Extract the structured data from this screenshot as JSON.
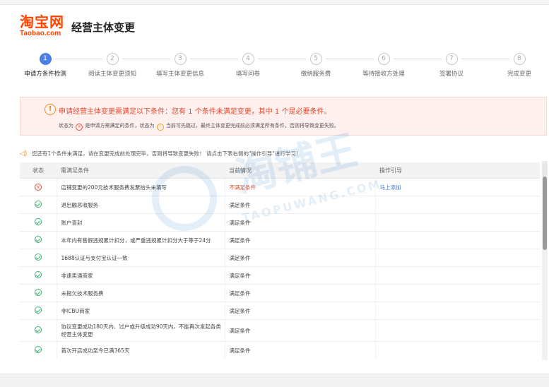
{
  "logo": {
    "cn": "淘宝网",
    "en": "Taobao.com"
  },
  "page_title": "经营主体变更",
  "steps": [
    {
      "num": "1",
      "label": "申请方条件检测",
      "active": true
    },
    {
      "num": "2",
      "label": "阅读主体变更须知",
      "active": false
    },
    {
      "num": "3",
      "label": "填写主体变更信息",
      "active": false
    },
    {
      "num": "4",
      "label": "填写问卷",
      "active": false
    },
    {
      "num": "5",
      "label": "缴纳服务费",
      "active": false
    },
    {
      "num": "6",
      "label": "等待接收方处理",
      "active": false
    },
    {
      "num": "7",
      "label": "签署协议",
      "active": false
    },
    {
      "num": "8",
      "label": "完成变更",
      "active": false
    }
  ],
  "alert": {
    "title": "申请经营主体变更需满足以下条件：您有 1 个条件未满足变更，其中 1 个是必要条件。",
    "sub_prefix": "状态为",
    "sub_mid": "是申请方需满足的条件，状态为",
    "sub_suffix": "当前可先跳过，最终主体变更完成前必须满足所有条件，否则将导致变更失败。"
  },
  "notice": "您还有1个条件未满足，请在变更完成前处理完毕，否则将导致变更失败！ 请点击下表右侧的\"操作引导\"进行学习！",
  "table": {
    "headers": {
      "status": "状态",
      "condition": "需满足条件",
      "current": "当前情况",
      "guide": "操作引导"
    },
    "rows": [
      {
        "status": "fail",
        "condition": "店铺变更的200元技术服务费发票抬头未填写",
        "current": "不满足条件",
        "guide": "马上添加"
      },
      {
        "status": "ok",
        "condition": "退出触恶收服务",
        "current": "满足条件",
        "guide": ""
      },
      {
        "status": "ok",
        "condition": "账户查封",
        "current": "满足条件",
        "guide": ""
      },
      {
        "status": "ok",
        "condition": "本年内有售假违规累计扣分，或严重违规累计扣分大于等于24分",
        "current": "满足条件",
        "guide": ""
      },
      {
        "status": "ok",
        "condition": "1688认证与支付宝认证一致",
        "current": "满足条件",
        "guide": ""
      },
      {
        "status": "ok",
        "condition": "非速卖通商家",
        "current": "满足条件",
        "guide": ""
      },
      {
        "status": "ok",
        "condition": "未拖欠技术服务费",
        "current": "满足条件",
        "guide": ""
      },
      {
        "status": "ok",
        "condition": "非ICBU商家",
        "current": "满足条件",
        "guide": ""
      },
      {
        "status": "ok",
        "condition": "协议变更成功180天内、过户或升级成功90天内，不能再次发起各类经营主体变更",
        "current": "满足条件",
        "guide": ""
      },
      {
        "status": "ok",
        "condition": "首次开店成功至今已满365天",
        "current": "满足条件",
        "guide": ""
      }
    ]
  },
  "watermark": {
    "cn": "淘铺王",
    "en": "TAOPUWANG.COM"
  },
  "colors": {
    "accent": "#4d7fe6",
    "brand": "#ff4400",
    "error": "#e8492f",
    "ok": "#3cb371",
    "link": "#3a6fd8"
  }
}
